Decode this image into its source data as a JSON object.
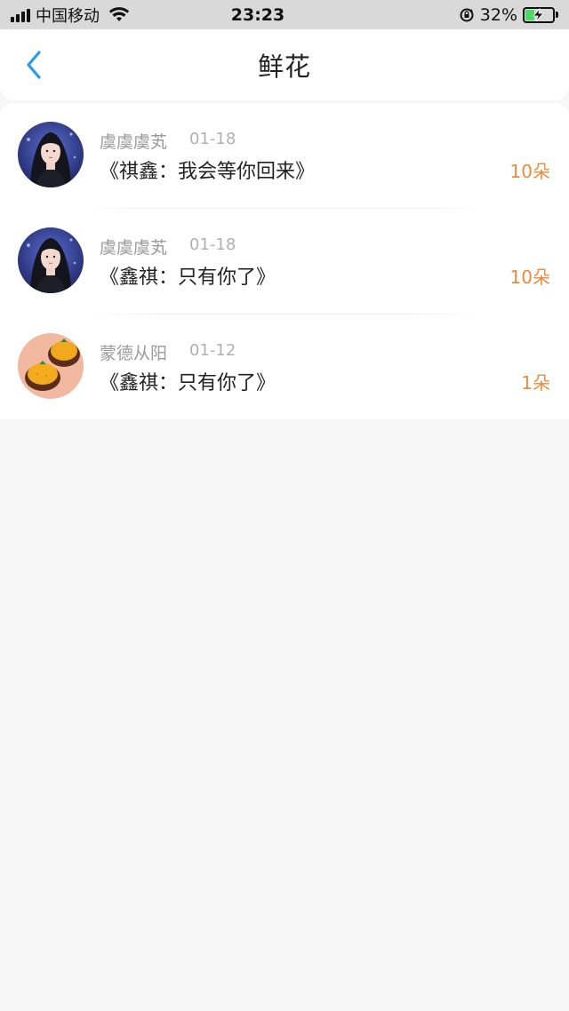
{
  "status_bar": {
    "carrier": "中国移动",
    "time": "23:23",
    "battery_percent": "32%",
    "battery_level": 0.32,
    "signal_bars": 4,
    "icons": [
      "signal-icon",
      "wifi-icon",
      "rotation-lock-icon",
      "battery-charging-icon"
    ]
  },
  "nav": {
    "title": "鲜花",
    "back_icon": "chevron-left-icon",
    "accent_color": "#2b9be8"
  },
  "list": {
    "items": [
      {
        "name": "虞虞虞芄",
        "date": "01-18",
        "title": "《祺鑫：我会等你回来》",
        "count": "10朵",
        "avatar": "portrait-avatar"
      },
      {
        "name": "虞虞虞芄",
        "date": "01-18",
        "title": "《鑫祺：只有你了》",
        "count": "10朵",
        "avatar": "portrait-avatar"
      },
      {
        "name": "蒙德从阳",
        "date": "01-12",
        "title": "《鑫祺：只有你了》",
        "count": "1朵",
        "avatar": "orange-tarts-avatar"
      }
    ]
  },
  "colors": {
    "count_color": "#f08a3c",
    "background": "#f7f7f7"
  }
}
